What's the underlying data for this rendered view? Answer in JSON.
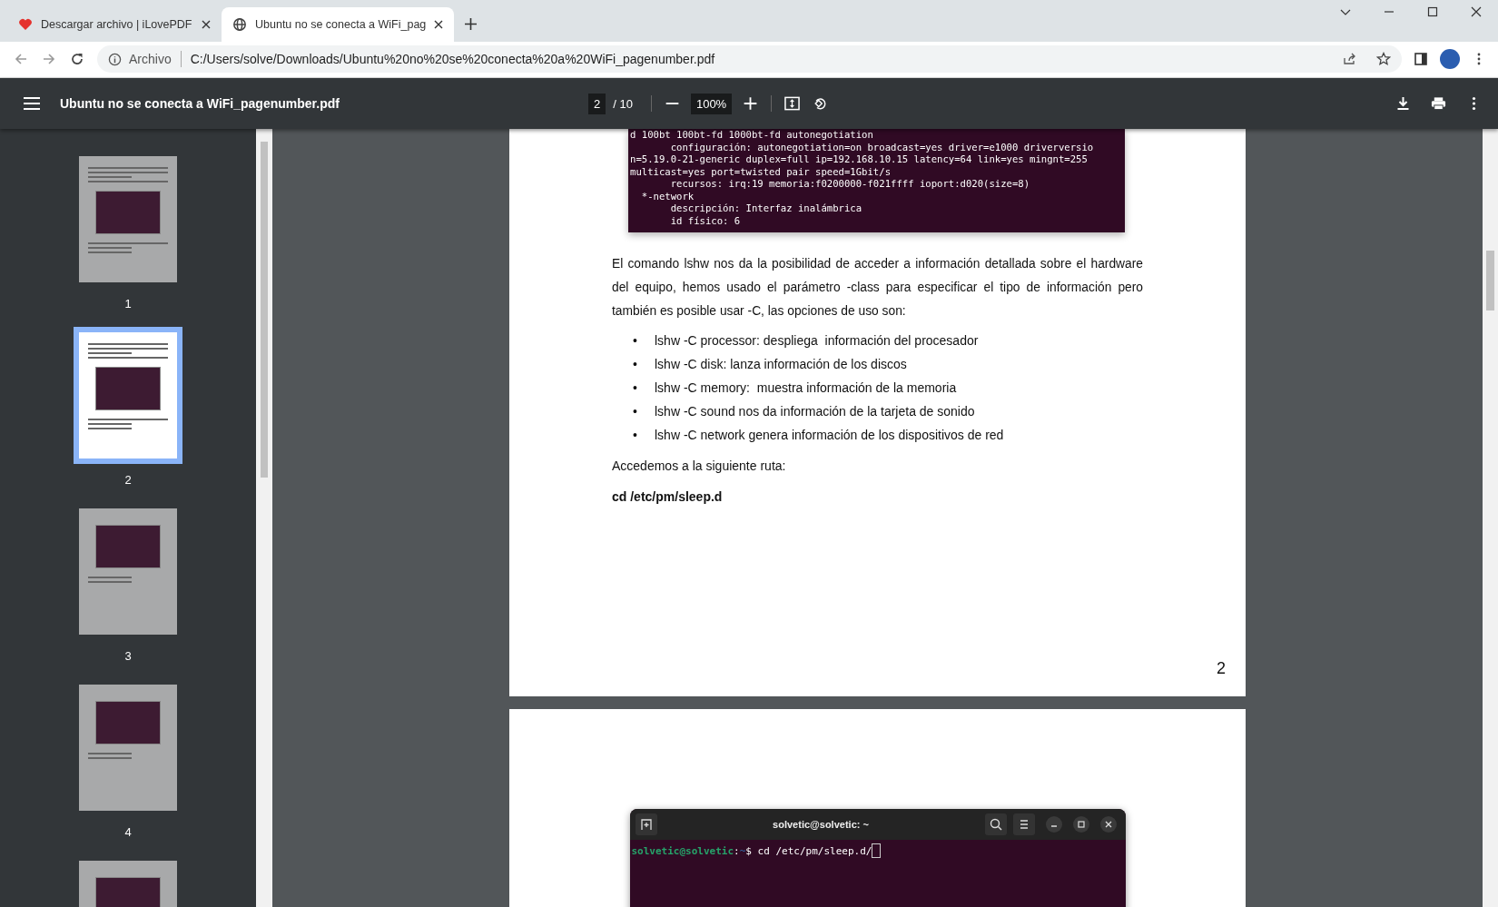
{
  "browser": {
    "tabs": [
      {
        "title": "Descargar archivo | iLovePDF",
        "kind": "heart",
        "selected": false
      },
      {
        "title": "Ubuntu no se conecta a WiFi_pag",
        "kind": "globe",
        "selected": true
      }
    ],
    "address": {
      "security_label": "Archivo",
      "url": "C:/Users/solve/Downloads/Ubuntu%20no%20se%20conecta%20a%20WiFi_pagenumber.pdf"
    }
  },
  "pdf_toolbar": {
    "title": "Ubuntu no se conecta a WiFi_pagenumber.pdf",
    "page_input": "2",
    "page_total": "/ 10",
    "zoom": "100%"
  },
  "thumbnails": [
    {
      "label": "1",
      "kind": "text",
      "selected": false
    },
    {
      "label": "2",
      "kind": "text",
      "selected": true
    },
    {
      "label": "3",
      "kind": "terminal",
      "selected": false
    },
    {
      "label": "4",
      "kind": "terminal",
      "selected": false
    },
    {
      "kind": "terminal",
      "selected": false
    }
  ],
  "page": {
    "terminal_lines": [
      "d 100bt 100bt-fd 1000bt-fd autonegotiation",
      "       configuración: autonegotiation=on broadcast=yes driver=e1000 driverversio",
      "n=5.19.0-21-generic duplex=full ip=192.168.10.15 latency=64 link=yes mingnt=255",
      "multicast=yes port=twisted pair speed=1Gbit/s",
      "       recursos: irq:19 memoria:f0200000-f021ffff ioport:d020(size=8)",
      "  *-network",
      "       descripción: Interfaz inalámbrica",
      "       id físico: 6"
    ],
    "paragraph": "El comando lshw nos da la posibilidad de acceder a información detallada sobre el hardware del equipo, hemos usado el parámetro -class para especificar el tipo de información pero también es posible usar -C, las opciones de uso son:",
    "bullet_marker": "•",
    "bullets": [
      "lshw -C processor: despliega  información del procesador",
      "lshw -C disk: lanza información de los discos",
      "lshw -C memory:  muestra información de la memoria",
      "lshw -C sound nos da información de la tarjeta de sonido",
      "lshw -C network genera información de los dispositivos de red"
    ],
    "route_intro": "Accedemos a la siguiente ruta:",
    "route_command": "cd /etc/pm/sleep.d",
    "page_number": "2"
  },
  "next_page": {
    "terminal": {
      "title": "solvetic@solvetic: ~",
      "prompt_user": "solvetic@solvetic",
      "prompt_separator": ":",
      "prompt_path": "~",
      "prompt_symbol": "$",
      "command": "cd /etc/pm/sleep.d/"
    }
  }
}
